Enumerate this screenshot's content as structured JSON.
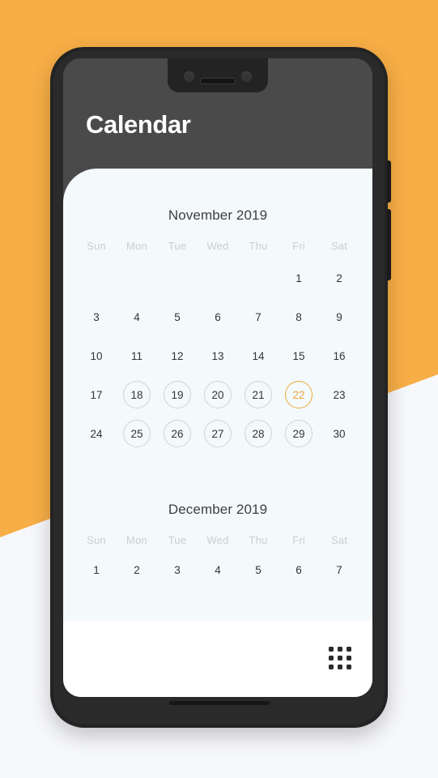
{
  "theme": {
    "accent": "#f7ae46",
    "today_accent": "#eda63c",
    "phone_body": "#232323",
    "header_bg": "#4a4a4a",
    "card_bg": "#f4f9fb",
    "bottom_bar_bg": "#ffffff",
    "day_text": "#31353a",
    "weekday_text": "#c9ced2",
    "ring": "#cfd4d6"
  },
  "app": {
    "title": "Calendar"
  },
  "weekdays": [
    "Sun",
    "Mon",
    "Tue",
    "Wed",
    "Thu",
    "Fri",
    "Sat"
  ],
  "months": [
    {
      "id": "november",
      "title": "November 2019",
      "weeks": [
        [
          {
            "label": "",
            "state": "empty"
          },
          {
            "label": "",
            "state": "empty"
          },
          {
            "label": "",
            "state": "empty"
          },
          {
            "label": "",
            "state": "empty"
          },
          {
            "label": "",
            "state": "empty"
          },
          {
            "label": "1",
            "state": "plain"
          },
          {
            "label": "2",
            "state": "plain"
          }
        ],
        [
          {
            "label": "3",
            "state": "plain"
          },
          {
            "label": "4",
            "state": "plain"
          },
          {
            "label": "5",
            "state": "plain"
          },
          {
            "label": "6",
            "state": "plain"
          },
          {
            "label": "7",
            "state": "plain"
          },
          {
            "label": "8",
            "state": "plain"
          },
          {
            "label": "9",
            "state": "plain"
          }
        ],
        [
          {
            "label": "10",
            "state": "plain"
          },
          {
            "label": "11",
            "state": "plain"
          },
          {
            "label": "12",
            "state": "plain"
          },
          {
            "label": "13",
            "state": "plain"
          },
          {
            "label": "14",
            "state": "plain"
          },
          {
            "label": "15",
            "state": "plain"
          },
          {
            "label": "16",
            "state": "plain"
          }
        ],
        [
          {
            "label": "17",
            "state": "plain"
          },
          {
            "label": "18",
            "state": "ringed"
          },
          {
            "label": "19",
            "state": "ringed"
          },
          {
            "label": "20",
            "state": "ringed"
          },
          {
            "label": "21",
            "state": "ringed"
          },
          {
            "label": "22",
            "state": "today"
          },
          {
            "label": "23",
            "state": "plain"
          }
        ],
        [
          {
            "label": "24",
            "state": "plain"
          },
          {
            "label": "25",
            "state": "ringed"
          },
          {
            "label": "26",
            "state": "ringed"
          },
          {
            "label": "27",
            "state": "ringed"
          },
          {
            "label": "28",
            "state": "ringed"
          },
          {
            "label": "29",
            "state": "ringed"
          },
          {
            "label": "30",
            "state": "plain"
          }
        ]
      ]
    },
    {
      "id": "december",
      "title": "December 2019",
      "weeks": [
        [
          {
            "label": "1",
            "state": "plain"
          },
          {
            "label": "2",
            "state": "plain"
          },
          {
            "label": "3",
            "state": "plain"
          },
          {
            "label": "4",
            "state": "plain"
          },
          {
            "label": "5",
            "state": "plain"
          },
          {
            "label": "6",
            "state": "plain"
          },
          {
            "label": "7",
            "state": "plain"
          }
        ]
      ]
    }
  ],
  "bottom_bar": {
    "grid_icon": "apps-grid-icon"
  }
}
